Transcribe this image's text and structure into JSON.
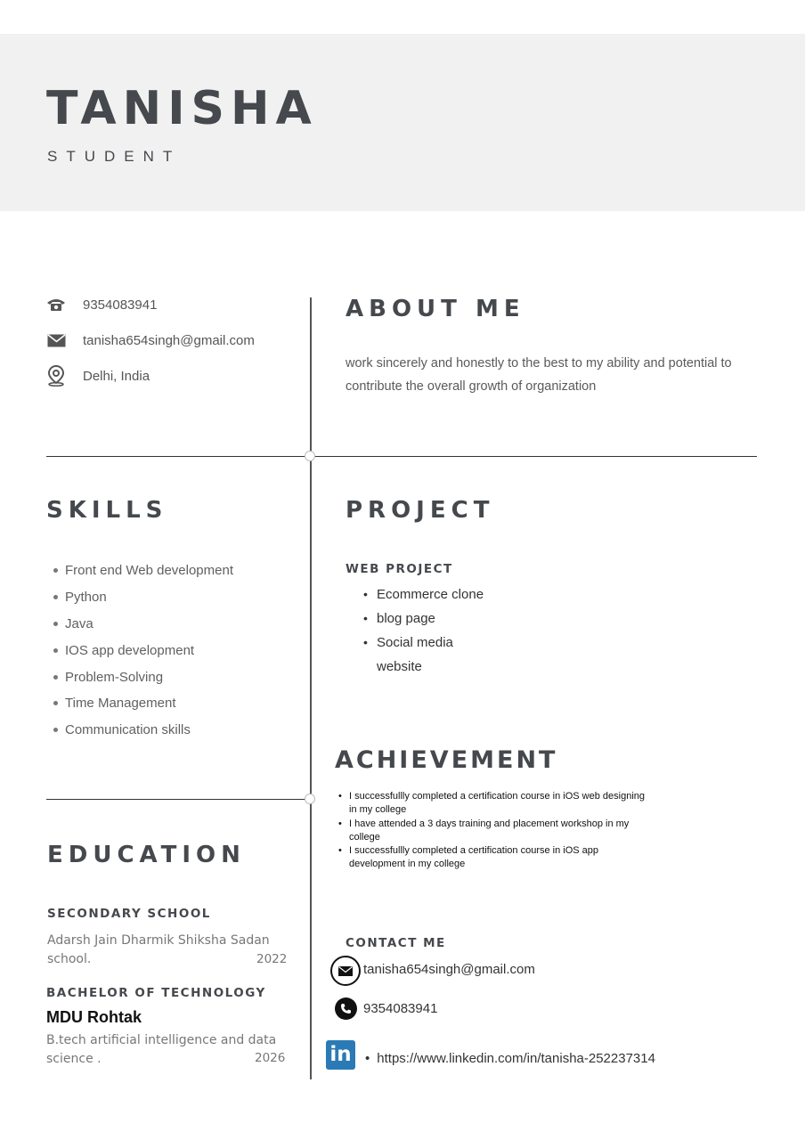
{
  "header": {
    "name": "TANISHA",
    "role": "STUDENT"
  },
  "contact": {
    "phone": "9354083941",
    "email": "tanisha654singh@gmail.com",
    "location": "Delhi, India"
  },
  "about": {
    "title": "ABOUT ME",
    "text": " work sincerely and honestly to the best to my ability and potential to contribute the overall growth of organization"
  },
  "skills": {
    "title": "SKILLS",
    "items": [
      "Front end Web development",
      "Python",
      "Java",
      "IOS app development",
      "Problem-Solving",
      "Time Management",
      "Communication skills"
    ]
  },
  "project": {
    "title": "PROJECT",
    "subtitle": "WEB PROJECT",
    "items": [
      "Ecommerce clone",
      "blog page",
      "Social media website"
    ]
  },
  "achievement": {
    "title": "ACHIEVEMENT",
    "items": [
      "I successfullly completed a certification course in iOS web designing in my college",
      "I have  attended a 3 days training  and placement workshop in my college",
      "I successfullly completed a certification course in iOS app development in my college"
    ]
  },
  "education": {
    "title": "EDUCATION",
    "secondary": {
      "heading": "SECONDARY SCHOOL",
      "school": "Adarsh Jain Dharmik Shiksha Sadan school.",
      "year": "2022"
    },
    "bachelor": {
      "heading": "BACHELOR OF TECHNOLOGY",
      "institute": "MDU Rohtak",
      "course": "B.tech artificial intelligence and data science .",
      "year": "2026"
    }
  },
  "contact_me": {
    "title": "CONTACT ME",
    "email": "tanisha654singh@gmail.com",
    "phone": "9354083941",
    "linkedin": "https://www.linkedin.com/in/tanisha-252237314",
    "linkedin_icon_label": "in"
  },
  "icons": [
    "phone-icon",
    "mail-icon",
    "location-pin-icon",
    "linkedin-icon"
  ]
}
